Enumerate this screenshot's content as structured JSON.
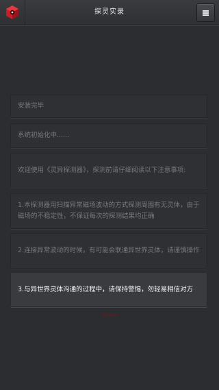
{
  "header": {
    "title": "探灵实录",
    "logo_icon": "red-cube-logo",
    "menu_icon": "hamburger-menu-icon",
    "accent_color": "#d0202a"
  },
  "messages": [
    {
      "text": "安装完毕",
      "active": false
    },
    {
      "text": "系统初始化中......",
      "active": false
    },
    {
      "text": "欢迎使用《灵异探测器》，探测前请仔细阅读以下注意事项:",
      "active": false
    },
    {
      "text": "1.本探测器用扫描异常磁场波动的方式探测周围有无灵体，由于磁场的不稳定性，不保证每次的探测结果均正确",
      "active": false
    },
    {
      "text": "2.连接异常波动的时候，有可能会联通异世界灵体，请谨慎操作",
      "active": false
    },
    {
      "text": "3.与异世界灵体沟通的过程中，请保持警惕，勿轻易相信对方",
      "active": true
    }
  ]
}
